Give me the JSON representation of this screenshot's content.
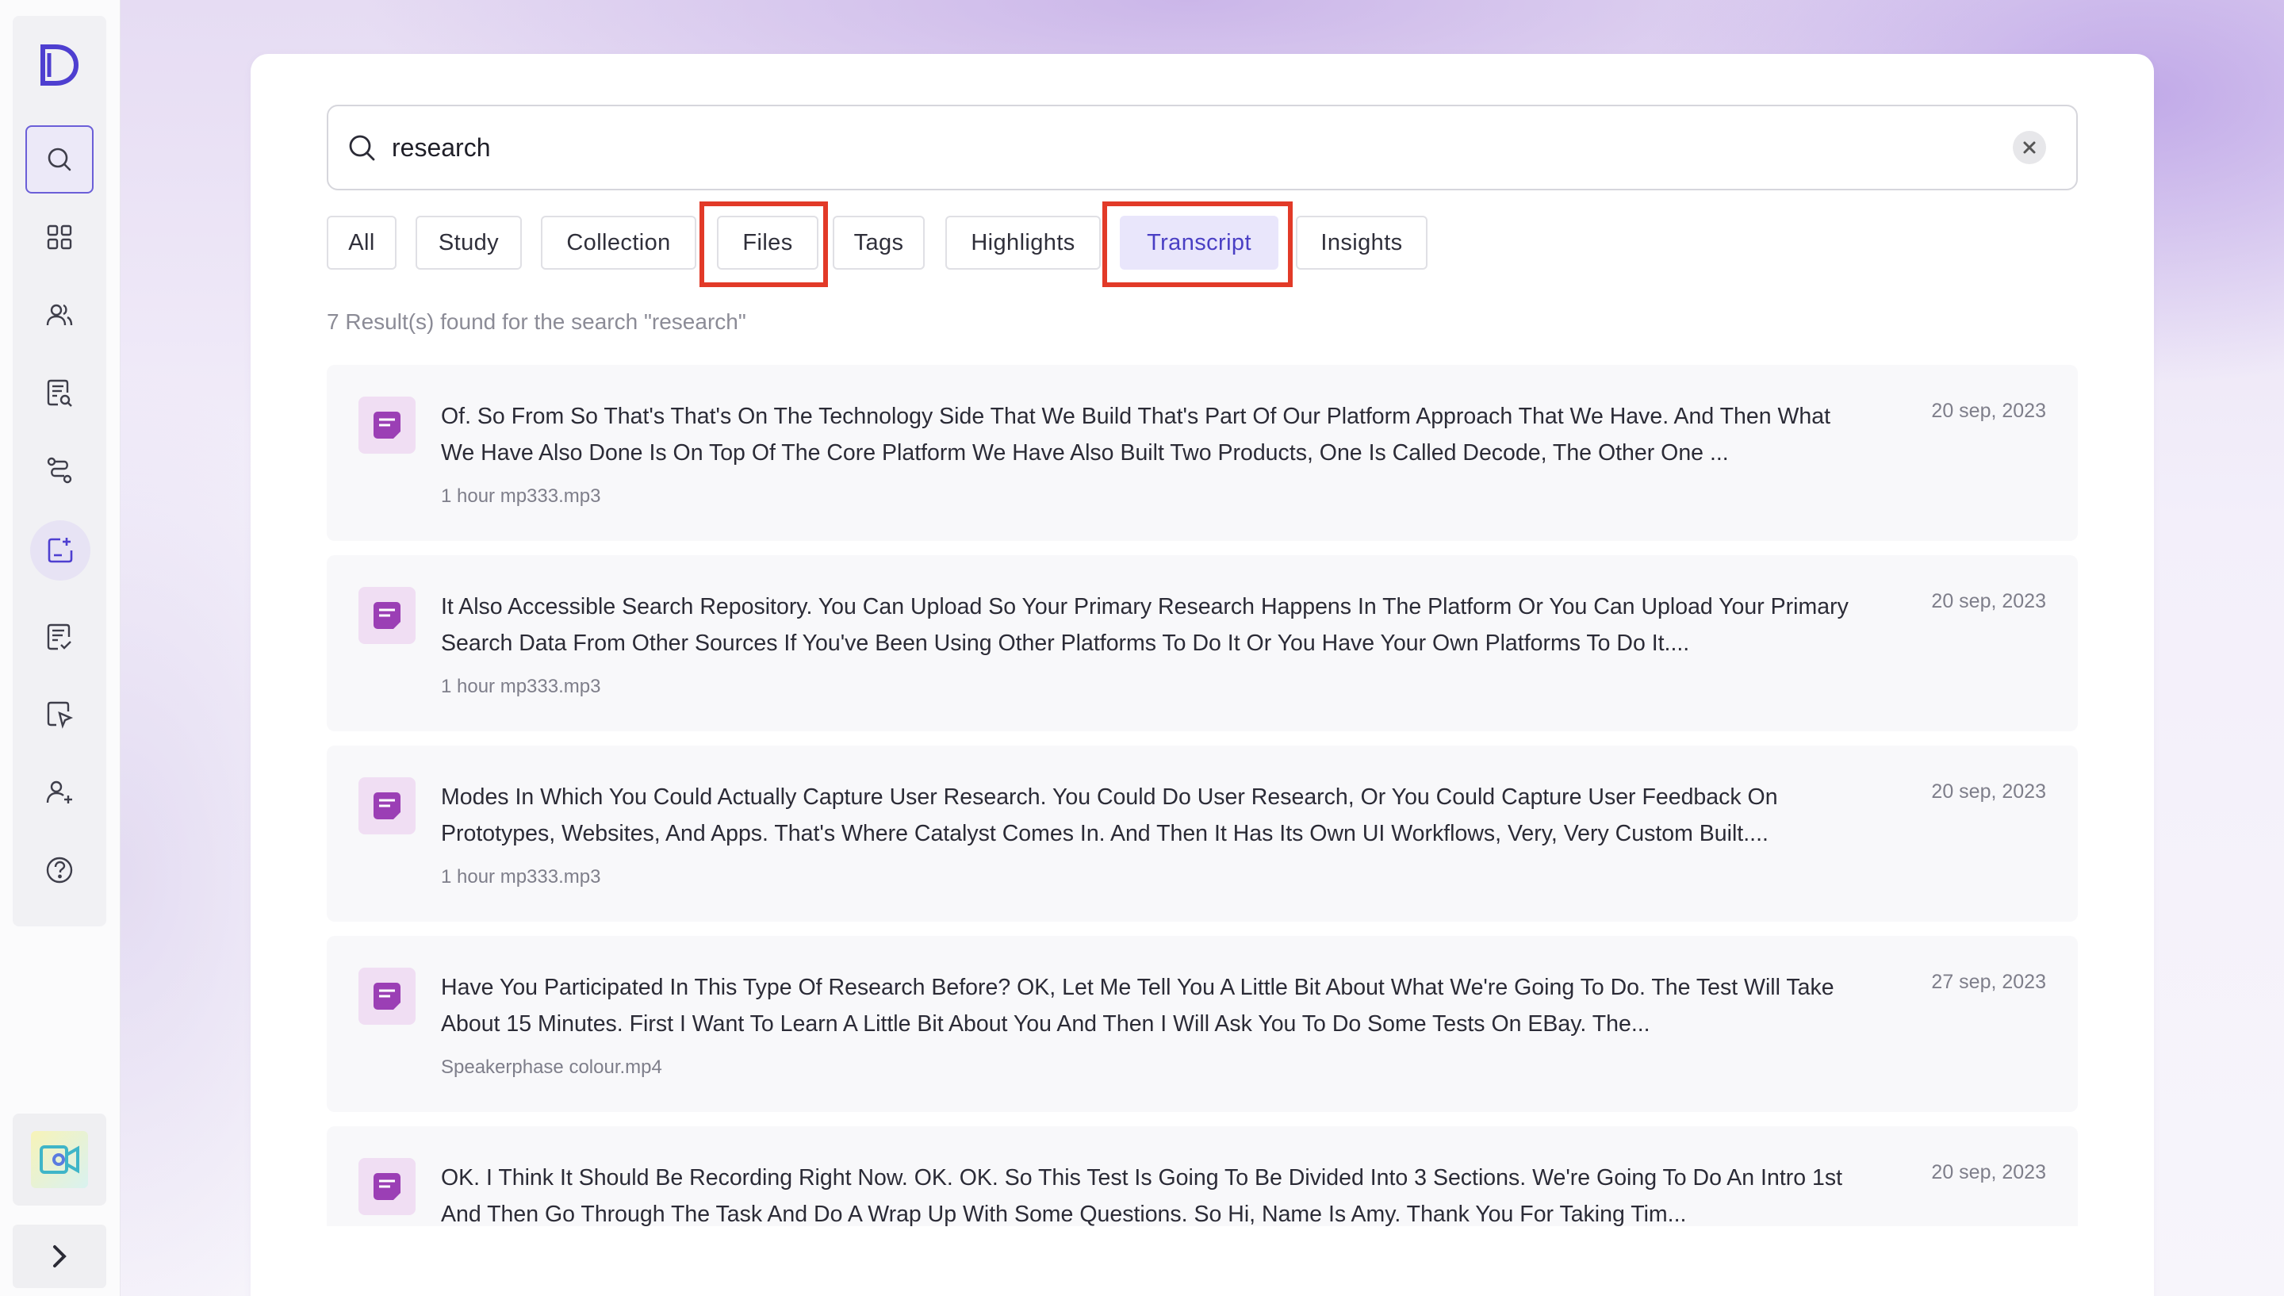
{
  "search": {
    "value": "research",
    "icon": "search-icon",
    "clear_icon": "close-icon"
  },
  "tabs": [
    {
      "label": "All"
    },
    {
      "label": "Study"
    },
    {
      "label": "Collection"
    },
    {
      "label": "Files"
    },
    {
      "label": "Tags"
    },
    {
      "label": "Highlights"
    },
    {
      "label": "Transcript",
      "active": true
    },
    {
      "label": "Insights"
    }
  ],
  "results_summary": "7 Result(s) found for the search \"research\"",
  "results": [
    {
      "text": "Of. So From So That's That's On The Technology Side That We Build That's Part Of Our Platform Approach That We Have. And Then What We Have Also Done Is On Top Of The Core Platform We Have Also Built Two Products, One Is Called Decode, The Other One ...",
      "meta": "1 hour mp333.mp3",
      "date": "20 sep, 2023"
    },
    {
      "text": "It Also Accessible Search Repository. You Can Upload So Your Primary Research Happens In The Platform Or You Can Upload Your Primary Search Data From Other Sources If You've Been Using Other Platforms To Do It Or You Have Your Own Platforms To Do It....",
      "meta": "1 hour mp333.mp3",
      "date": "20 sep, 2023"
    },
    {
      "text": "Modes In Which You Could Actually Capture User Research. You Could Do User Research, Or You Could Capture User Feedback On Prototypes, Websites, And Apps. That's Where Catalyst Comes In. And Then It Has Its Own UI Workflows, Very, Very Custom Built....",
      "meta": "1 hour mp333.mp3",
      "date": "20 sep, 2023"
    },
    {
      "text": "Have You Participated In This Type Of Research Before? OK, Let Me Tell You A Little Bit About What We're Going To Do. The Test Will Take About 15 Minutes. First I Want To Learn A Little Bit About You And Then I Will Ask You To Do Some Tests On EBay. The...",
      "meta": "Speakerphase colour.mp4",
      "date": "27 sep, 2023"
    },
    {
      "text": "OK. I Think It Should Be Recording Right Now. OK. OK. So This Test Is Going To Be Divided Into 3 Sections. We're Going To Do An Intro 1st And Then Go Through The Task And Do A Wrap Up With Some Questions. So Hi, Name Is Amy. Thank You For Taking Tim...",
      "meta": "",
      "date": "20 sep, 2023"
    }
  ],
  "sidebar": {
    "logo_letter": "D",
    "items": [
      {
        "icon": "search-icon",
        "active": true
      },
      {
        "icon": "grid-icon"
      },
      {
        "icon": "users-icon"
      },
      {
        "icon": "document-list-icon"
      },
      {
        "icon": "route-icon"
      },
      {
        "icon": "add-board-icon"
      },
      {
        "icon": "checklist-icon"
      },
      {
        "icon": "pointer-document-icon"
      },
      {
        "icon": "add-user-icon"
      },
      {
        "icon": "help-icon"
      }
    ],
    "expand_icon": "chevron-right-icon"
  },
  "colors": {
    "accent": "#4a3fc4",
    "active_tab_bg": "#e9e6fb",
    "highlight_box": "#e23a28",
    "doc_icon": "#9b3fb5"
  }
}
